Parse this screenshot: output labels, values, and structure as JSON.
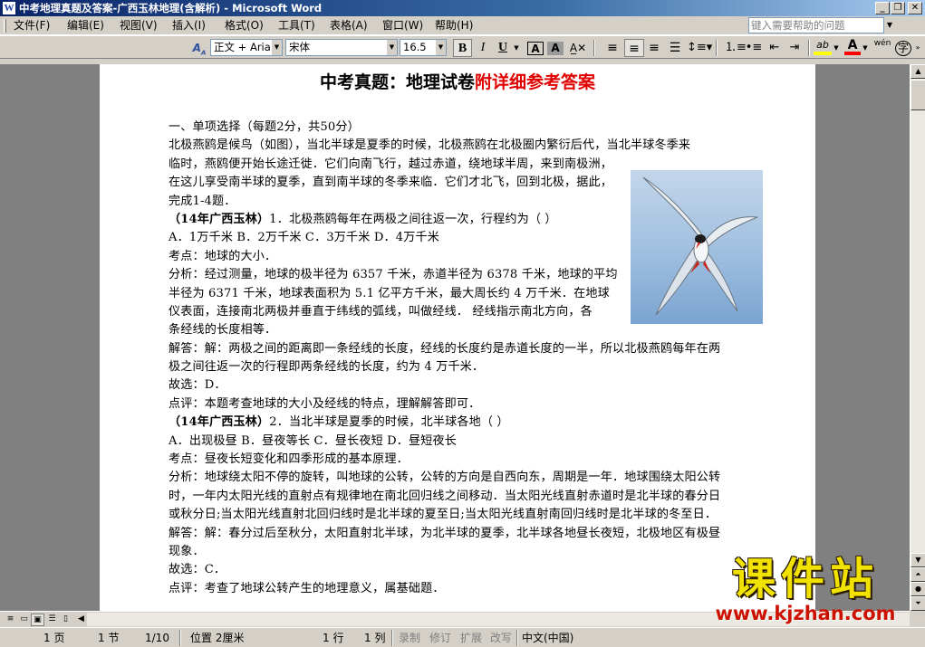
{
  "window": {
    "title": "中考地理真题及答案-广西玉林地理(含解析) - Microsoft Word",
    "app_icon": "W",
    "buttons": {
      "minimize": "_",
      "restore": "❐",
      "close": "✕"
    }
  },
  "menu": {
    "items": [
      "文件(F)",
      "编辑(E)",
      "视图(V)",
      "插入(I)",
      "格式(O)",
      "工具(T)",
      "表格(A)",
      "窗口(W)",
      "帮助(H)"
    ],
    "help_placeholder": "键入需要帮助的问题"
  },
  "toolbar": {
    "style": "正文 + Aria",
    "font": "宋体",
    "size": "16.5",
    "bold": "B",
    "italic": "I",
    "underline": "U",
    "char_border": "A",
    "char_shade": "A",
    "highlight": "ab",
    "font_color": "A",
    "phonetic": "wén",
    "encircle": "字"
  },
  "document": {
    "title_part1": "中考真题：地理试卷",
    "title_part2": "附详细参考答案",
    "lines": [
      {
        "bold": "",
        "text": "一、单项选择（每题2分，共50分）"
      },
      {
        "bold": "",
        "text": "    北极燕鸥是候鸟（如图），当北半球是夏季的时候，北极燕鸥在北极圈内繁衍后代，当北半球冬季来"
      },
      {
        "bold": "",
        "text": "临时，燕鸥便开始长途迁徙．它们向南飞行，越过赤道，绕地球半周，来到南极洲，"
      },
      {
        "bold": "",
        "text": "在这儿享受南半球的夏季，直到南半球的冬季来临．它们才北飞，回到北极，据此，"
      },
      {
        "bold": "",
        "text": "完成1-4题．"
      },
      {
        "bold": "（14年广西玉林）",
        "text": "1．北极燕鸥每年在两极之间往返一次，行程约为（    ）"
      },
      {
        "bold": "",
        "text": "  A．1万千米    B．2万千米    C．3万千米    D．4万千米"
      },
      {
        "bold": "",
        "text": "考点：地球的大小．"
      },
      {
        "bold": "",
        "text": "分析：经过测量，地球的极半径为 6357 千米，赤道半径为 6378 千米，地球的平均"
      },
      {
        "bold": "",
        "text": "半径为 6371 千米，地球表面积为 5.1 亿平方千米，最大周长约 4 万千米．在地球"
      },
      {
        "bold": "",
        "text": "仪表面，连接南北两极并垂直于纬线的弧线，叫做经线．  经线指示南北方向，各"
      },
      {
        "bold": "",
        "text": "条经线的长度相等．"
      },
      {
        "bold": "",
        "text": "解答：解：两极之间的距离即一条经线的长度，经线的长度约是赤道长度的一半，所以北极燕鸥每年在两"
      },
      {
        "bold": "",
        "text": "极之间往返一次的行程即两条经线的长度，约为 4 万千米．"
      },
      {
        "bold": "",
        "text": "故选：D．"
      },
      {
        "bold": "",
        "text": "点评：本题考查地球的大小及经线的特点，理解解答即可．"
      },
      {
        "bold": "（14年广西玉林）",
        "text": "2．当北半球是夏季的时候，北半球各地（    ）"
      },
      {
        "bold": "",
        "text": "  A．出现极昼    B．昼夜等长      C．昼长夜短     D．昼短夜长"
      },
      {
        "bold": "",
        "text": "考点：昼夜长短变化和四季形成的基本原理．"
      },
      {
        "bold": "",
        "text": "分析：地球绕太阳不停的旋转，叫地球的公转，公转的方向是自西向东，周期是一年．地球围绕太阳公转"
      },
      {
        "bold": "",
        "text": "时，一年内太阳光线的直射点有规律地在南北回归线之间移动．当太阳光线直射赤道时是北半球的春分日"
      },
      {
        "bold": "",
        "text": "或秋分日;当太阳光线直射北回归线时是北半球的夏至日;当太阳光线直射南回归线时是北半球的冬至日．"
      },
      {
        "bold": "",
        "text": "解答：解：春分过后至秋分，太阳直射北半球，为北半球的夏季，北半球各地昼长夜短，北极地区有极昼"
      },
      {
        "bold": "",
        "text": "现象．"
      },
      {
        "bold": "",
        "text": "故选：C．"
      },
      {
        "bold": "",
        "text": "点评：考查了地球公转产生的地理意义，属基础题．"
      }
    ]
  },
  "status": {
    "page": "1 页",
    "section": "1 节",
    "pages": "1/10",
    "position": "位置 2厘米",
    "line": "1 行",
    "col": "1 列",
    "rec": "录制",
    "trk": "修订",
    "ext": "扩展",
    "ovr": "改写",
    "lang": "中文(中国)"
  },
  "watermark": {
    "text": "课件站",
    "url": "www.kjzhan.com"
  },
  "colors": {
    "title_red": "#e00000",
    "titlebar": "#0a246a",
    "watermark_yellow": "#f2e200",
    "watermark_red": "#cc1100"
  }
}
